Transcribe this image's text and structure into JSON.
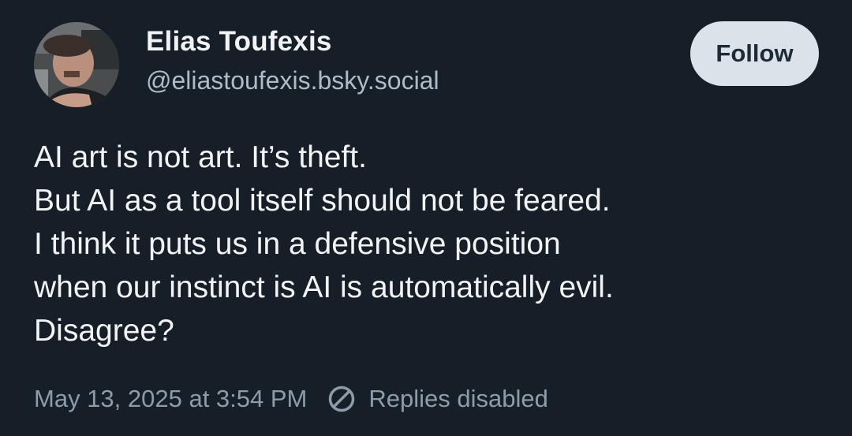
{
  "author": {
    "name": "Elias Toufexis",
    "handle": "@eliastoufexis.bsky.social",
    "avatar_icon": "user-avatar-photo"
  },
  "follow_button": {
    "label": "Follow"
  },
  "post": {
    "lines": [
      "AI art is not art. It’s theft.",
      "But AI as a tool itself should not be feared.",
      "I think it puts us in a defensive position",
      "when our instinct is AI is automatically evil.",
      "Disagree?"
    ],
    "timestamp": "May 13, 2025 at 3:54 PM",
    "replies_status": "Replies disabled",
    "replies_icon": "no-entry-icon"
  },
  "colors": {
    "background": "#161e27",
    "text_primary": "#f1f3f5",
    "text_handle": "#aebbc9",
    "text_meta": "#8d9cab",
    "follow_bg": "#dce2ea",
    "follow_text": "#1e2a36"
  }
}
